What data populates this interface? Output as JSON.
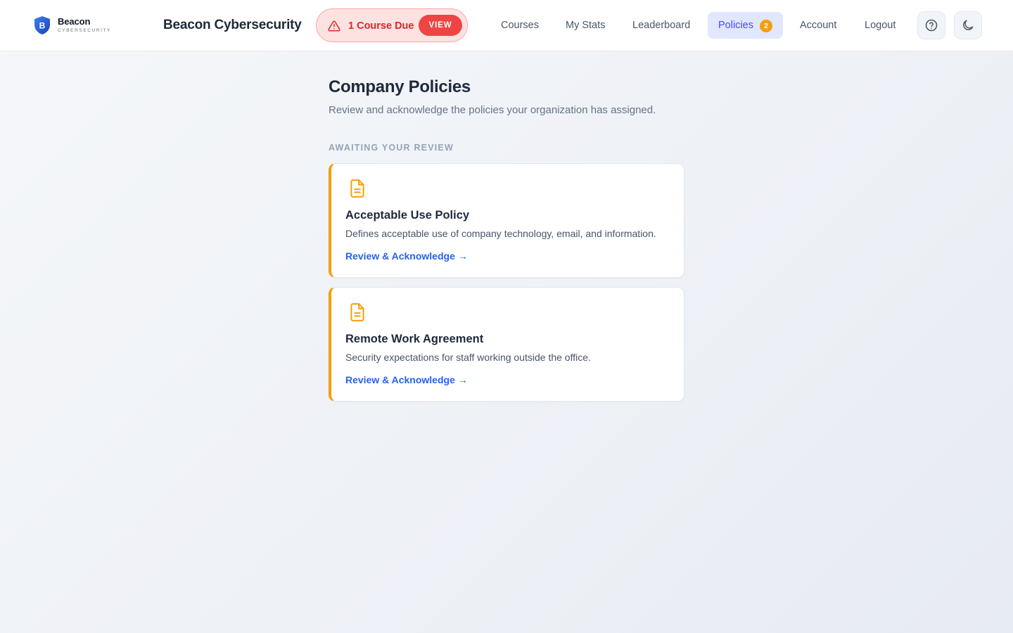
{
  "app": {
    "logo_name": "Beacon",
    "logo_sub": "CYBERSECURITY",
    "logo_letter": "B",
    "title": "Beacon Cybersecurity"
  },
  "alert": {
    "text": "1 Course Due",
    "button": "VIEW",
    "icon": "warning-triangle-icon"
  },
  "nav": {
    "items": [
      {
        "label": "Courses"
      },
      {
        "label": "My Stats"
      },
      {
        "label": "Leaderboard"
      },
      {
        "label": "Policies",
        "badge": "2",
        "active": true
      },
      {
        "label": "Account"
      },
      {
        "label": "Logout"
      }
    ],
    "help_icon": "help-circle-icon",
    "theme_icon": "moon-icon"
  },
  "page": {
    "title": "Company Policies",
    "subtitle": "Review and acknowledge the policies your organization has assigned.",
    "section_label": "AWAITING YOUR REVIEW"
  },
  "policies": [
    {
      "title": "Acceptable Use Policy",
      "description": "Defines acceptable use of company technology, email, and information.",
      "action": "Review & Acknowledge →",
      "icon": "document-icon"
    },
    {
      "title": "Remote Work Agreement",
      "description": "Security expectations for staff working outside the office.",
      "action": "Review & Acknowledge →",
      "icon": "document-icon"
    }
  ],
  "colors": {
    "accent": "#4f46e5",
    "accent_bg": "#e0e7ff",
    "alert": "#ef4444",
    "alert_bg": "#fee2e2",
    "pending": "#f59e0b",
    "link": "#2563eb",
    "logo": "#1d4ed8"
  }
}
